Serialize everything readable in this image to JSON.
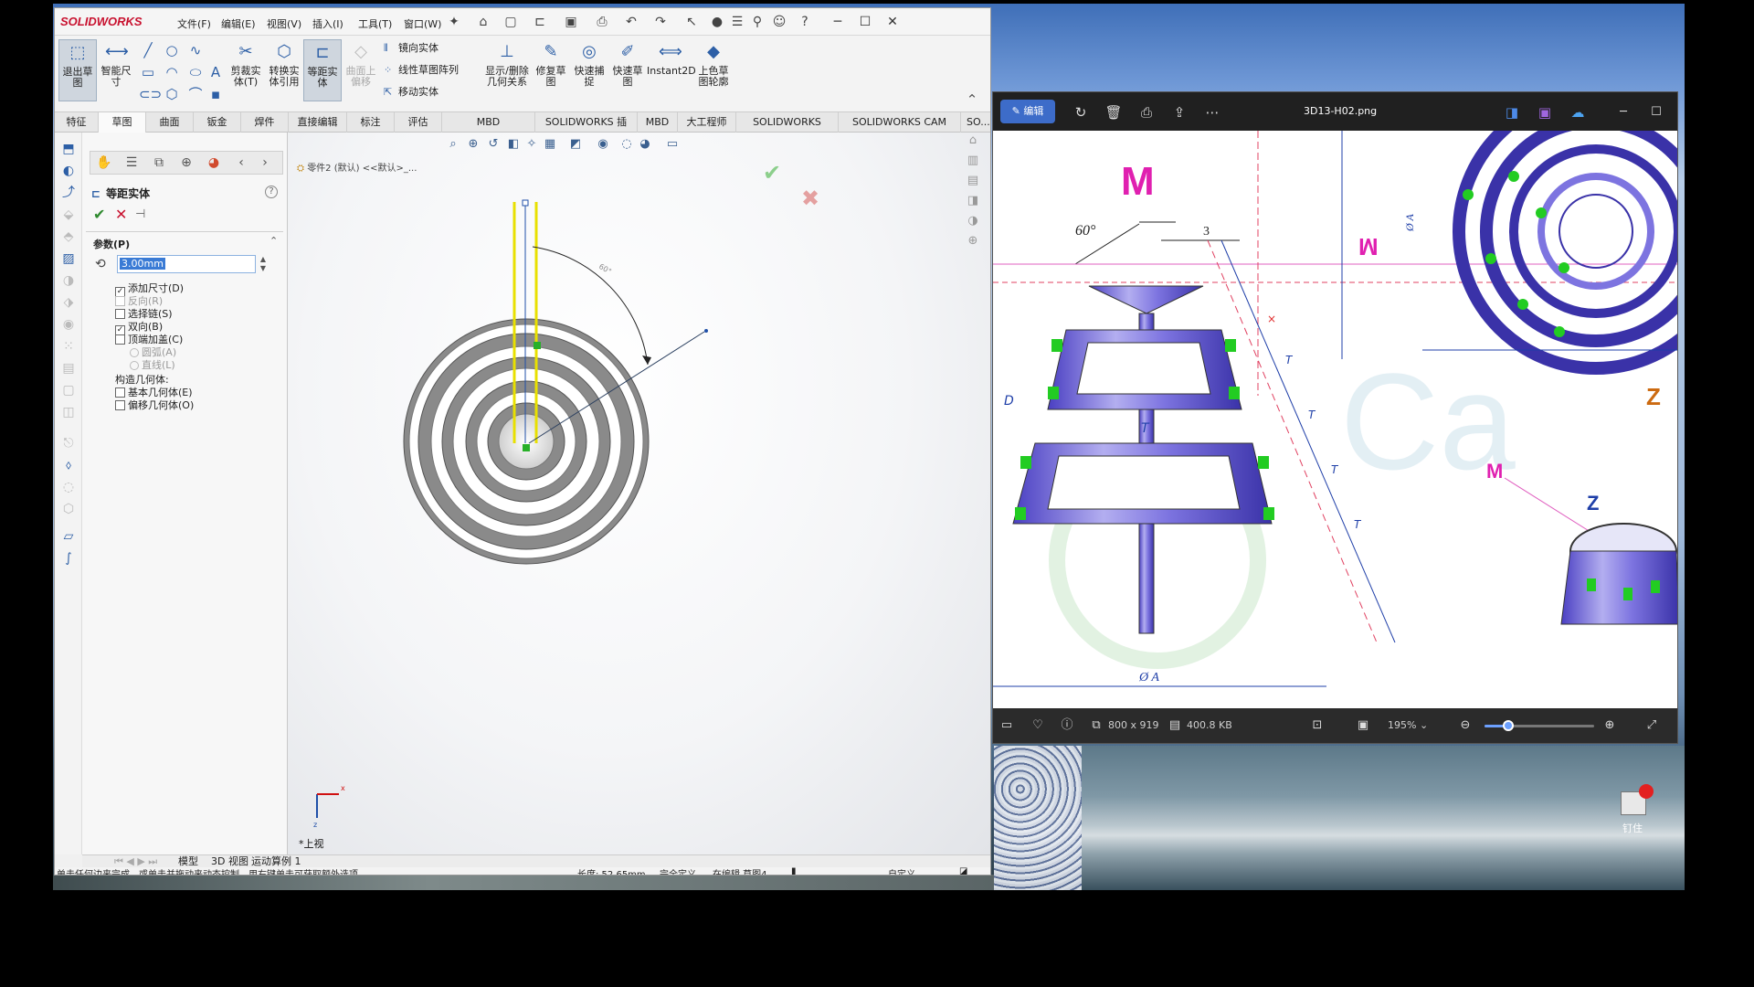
{
  "solidworks": {
    "logo": "SOLIDWORKS",
    "menus": [
      "文件(F)",
      "编辑(E)",
      "视图(V)",
      "插入(I)",
      "工具(T)",
      "窗口(W)"
    ],
    "ribbon": {
      "exit_sketch": "退出草图",
      "smart_dim": "智能尺寸",
      "trim": "剪裁实体(T)",
      "convert": "转换实体引用",
      "offset": "等距实体",
      "surface_offset": "曲面上偏移",
      "mirror": "镜向实体",
      "linear_pattern": "线性草图阵列",
      "move": "移动实体",
      "show_relations": "显示/删除几何关系",
      "repair": "修复草图",
      "quick_snap": "快速捕捉",
      "rapid_sketch": "快速草图",
      "instant2d": "Instant2D",
      "shaded": "上色草图轮廓"
    },
    "tabs": [
      "特征",
      "草图",
      "曲面",
      "钣金",
      "焊件",
      "直接编辑",
      "标注",
      "评估",
      "MBD Dimensions",
      "SOLIDWORKS 插件",
      "MBD",
      "大工程师",
      "SOLIDWORKS CAM",
      "SOLIDWORKS CAM TBM",
      "SO..."
    ],
    "active_tab": "草图",
    "property_manager": {
      "title": "等距实体",
      "help": "?",
      "group": "参数(P)",
      "value": "3.00mm",
      "options": [
        {
          "label": "添加尺寸(D)",
          "checked": true,
          "disabled": false
        },
        {
          "label": "反向(R)",
          "checked": false,
          "disabled": true
        },
        {
          "label": "选择链(S)",
          "checked": false,
          "disabled": false
        },
        {
          "label": "双向(B)",
          "checked": true,
          "disabled": false
        },
        {
          "label": "顶端加盖(C)",
          "checked": false,
          "disabled": false
        }
      ],
      "caps": [
        {
          "label": "圆弧(A)",
          "selected": true
        },
        {
          "label": "直线(L)",
          "selected": false
        }
      ],
      "construction_label": "构造几何体:",
      "construction_options": [
        {
          "label": "基本几何体(E)",
          "checked": false
        },
        {
          "label": "偏移几何体(O)",
          "checked": false
        }
      ]
    },
    "tree_path": "零件2 (默认) <<默认>_...",
    "view_label": "*上视",
    "angle_label": "60°",
    "bottom_tabs": [
      "模型",
      "3D 视图",
      "运动算例 1"
    ],
    "status": {
      "hint": "单击任何边来完成，或单击并拖动来动态控制。用右键单击可获取额外选项。",
      "length": "长度: 52.65mm",
      "defined": "完全定义",
      "editing": "在编辑 草图4",
      "custom": "自定义"
    }
  },
  "photos": {
    "edit_label": "编辑",
    "filename": "3D13-H02.png",
    "dimensions": "800 x 919",
    "filesize": "400.8 KB",
    "zoom": "195%",
    "zoom_fraction": 0.22,
    "drawing": {
      "label_m": "M",
      "label_m_small": "M",
      "angle": "60°",
      "dim_3": "3",
      "dim_t": "T",
      "dim_d": "D",
      "dim_a": "Ø A",
      "dim_a_vertical": "Ø A",
      "label_z": "Z"
    }
  },
  "desktop": {
    "pin_label": "钉住"
  }
}
